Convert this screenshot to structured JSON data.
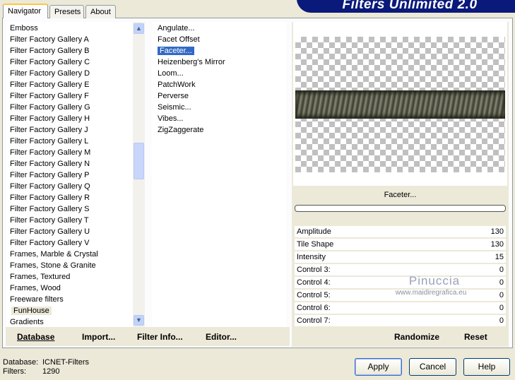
{
  "banner": "Filters Unlimited 2.0",
  "tabs": [
    "Navigator",
    "Presets",
    "About"
  ],
  "categories": [
    "Emboss",
    "Filter Factory Gallery A",
    "Filter Factory Gallery B",
    "Filter Factory Gallery C",
    "Filter Factory Gallery D",
    "Filter Factory Gallery E",
    "Filter Factory Gallery F",
    "Filter Factory Gallery G",
    "Filter Factory Gallery H",
    "Filter Factory Gallery J",
    "Filter Factory Gallery L",
    "Filter Factory Gallery M",
    "Filter Factory Gallery N",
    "Filter Factory Gallery P",
    "Filter Factory Gallery Q",
    "Filter Factory Gallery R",
    "Filter Factory Gallery S",
    "Filter Factory Gallery T",
    "Filter Factory Gallery U",
    "Filter Factory Gallery V",
    "Frames, Marble & Crystal",
    "Frames, Stone & Granite",
    "Frames, Textured",
    "Frames, Wood",
    "Freeware filters",
    "FunHouse",
    "Gradients"
  ],
  "selected_category": "FunHouse",
  "filters": [
    "Angulate...",
    "Facet Offset",
    "Faceter...",
    "Heizenberg's Mirror",
    "Loom...",
    "PatchWork",
    "Perverse",
    "Seismic...",
    "Vibes...",
    "ZigZaggerate"
  ],
  "selected_filter": "Faceter...",
  "left_buttons": [
    "Database",
    "Import...",
    "Filter Info...",
    "Editor..."
  ],
  "filter_name": "Faceter...",
  "controls": [
    {
      "label": "Amplitude",
      "value": "130"
    },
    {
      "label": "Tile Shape",
      "value": "130"
    },
    {
      "label": "Intensity",
      "value": "15"
    },
    {
      "label": "Control 3:",
      "value": "0"
    },
    {
      "label": "Control 4:",
      "value": "0"
    },
    {
      "label": "Control 5:",
      "value": "0"
    },
    {
      "label": "Control 6:",
      "value": "0"
    },
    {
      "label": "Control 7:",
      "value": "0"
    }
  ],
  "right_buttons": {
    "randomize": "Randomize",
    "reset": "Reset"
  },
  "watermark": {
    "name": "Pinuccia",
    "url": "www.maidiregrafica.eu"
  },
  "status": {
    "db_label": "Database:",
    "db_value": "ICNET-Filters",
    "filters_label": "Filters:",
    "filters_value": "1290"
  },
  "dialog_buttons": {
    "apply": "Apply",
    "cancel": "Cancel",
    "help": "Help"
  }
}
